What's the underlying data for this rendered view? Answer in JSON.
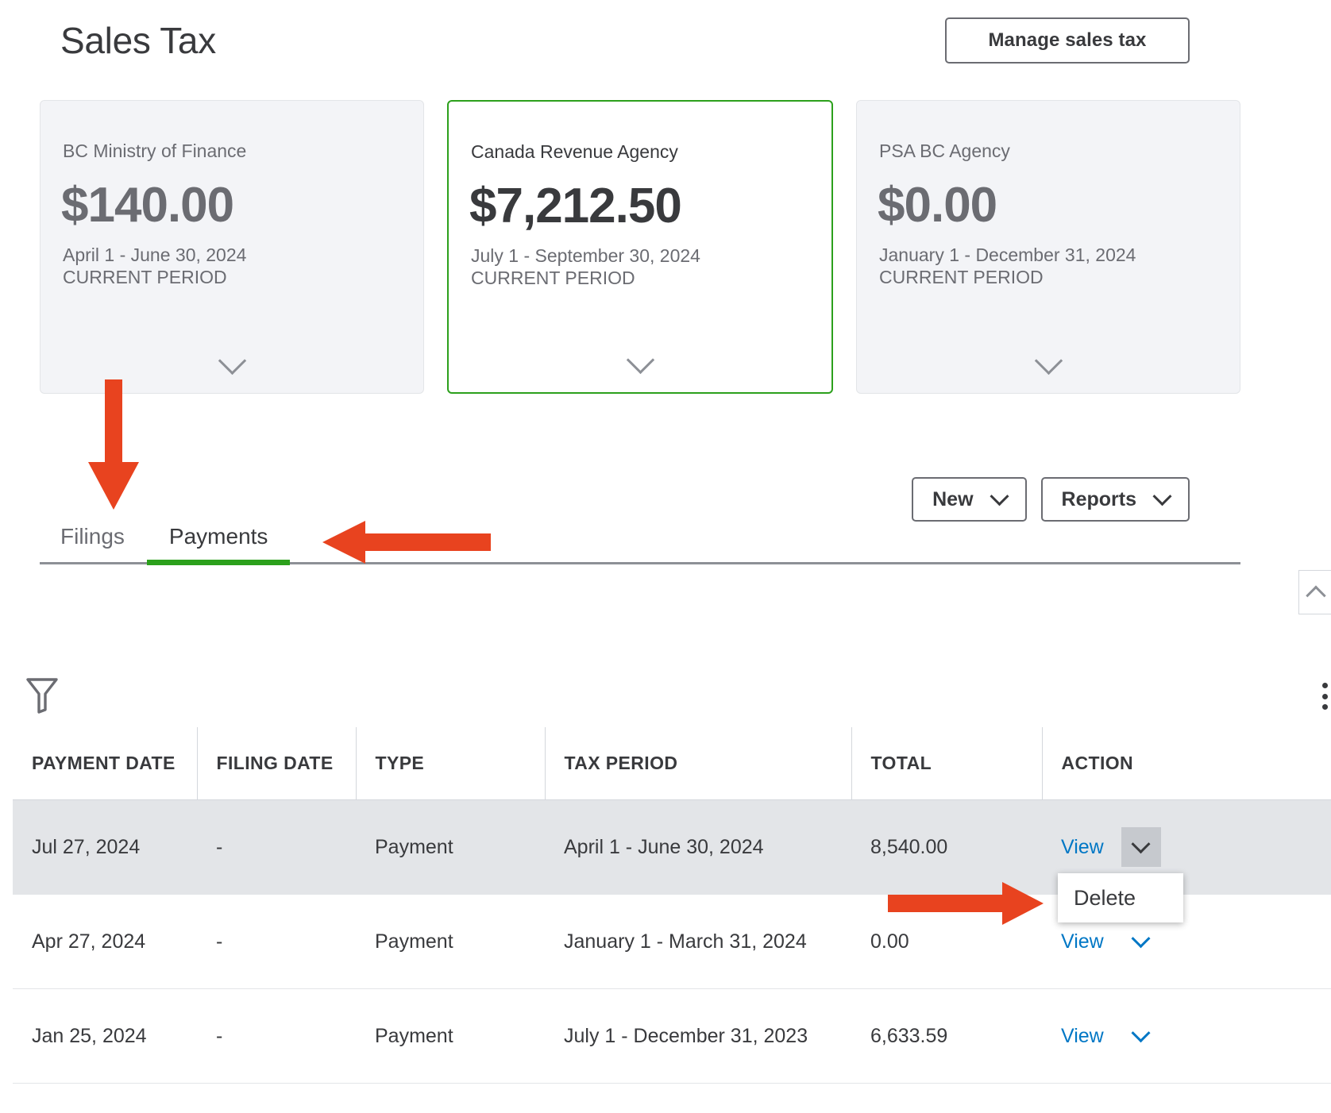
{
  "header": {
    "title": "Sales Tax",
    "manage_button_label": "Manage sales tax"
  },
  "agency_cards": [
    {
      "agency": "BC Ministry of Finance",
      "amount": "$140.00",
      "period": "April 1 - June 30, 2024",
      "period_label": "CURRENT PERIOD",
      "selected": false,
      "chevron_icon": "chevron-down-icon"
    },
    {
      "agency": "Canada Revenue Agency",
      "amount": "$7,212.50",
      "period": "July 1 - September 30, 2024",
      "period_label": "CURRENT PERIOD",
      "selected": true,
      "chevron_icon": "chevron-down-icon"
    },
    {
      "agency": "PSA BC Agency",
      "amount": "$0.00",
      "period": "January 1 - December 31, 2024",
      "period_label": "CURRENT PERIOD",
      "selected": false,
      "chevron_icon": "chevron-down-icon"
    }
  ],
  "toolbar": {
    "new_label": "New",
    "reports_label": "Reports"
  },
  "tabs": [
    {
      "label": "Filings",
      "active": false
    },
    {
      "label": "Payments",
      "active": true
    }
  ],
  "table": {
    "filter_icon": "filter-funnel-icon",
    "settings_icon": "settings-dots-icon",
    "columns": [
      "PAYMENT DATE",
      "FILING DATE",
      "TYPE",
      "TAX PERIOD",
      "TOTAL",
      "ACTION"
    ],
    "rows": [
      {
        "payment_date": "Jul 27, 2024",
        "filing_date": "-",
        "type": "Payment",
        "tax_period": "April 1 - June 30, 2024",
        "total": "8,540.00",
        "action_label": "View",
        "highlighted": true,
        "menu_open": true
      },
      {
        "payment_date": "Apr 27, 2024",
        "filing_date": "-",
        "type": "Payment",
        "tax_period": "January 1 - March 31, 2024",
        "total": "0.00",
        "action_label": "View",
        "highlighted": false,
        "menu_open": false
      },
      {
        "payment_date": "Jan 25, 2024",
        "filing_date": "-",
        "type": "Payment",
        "tax_period": "July 1 - December 31, 2023",
        "total": "6,633.59",
        "action_label": "View",
        "highlighted": false,
        "menu_open": false
      }
    ]
  },
  "context_menu": {
    "delete_label": "Delete"
  },
  "right_panel": {
    "collapse_icon": "chevron-up-icon"
  },
  "colors": {
    "accent_green": "#2ca01c",
    "link_blue": "#0077c5",
    "annotation_red": "#e8431f",
    "text_primary": "#393a3d",
    "text_secondary": "#6b6c72",
    "card_bg": "#f3f4f7",
    "row_highlight": "#e3e5e8"
  }
}
